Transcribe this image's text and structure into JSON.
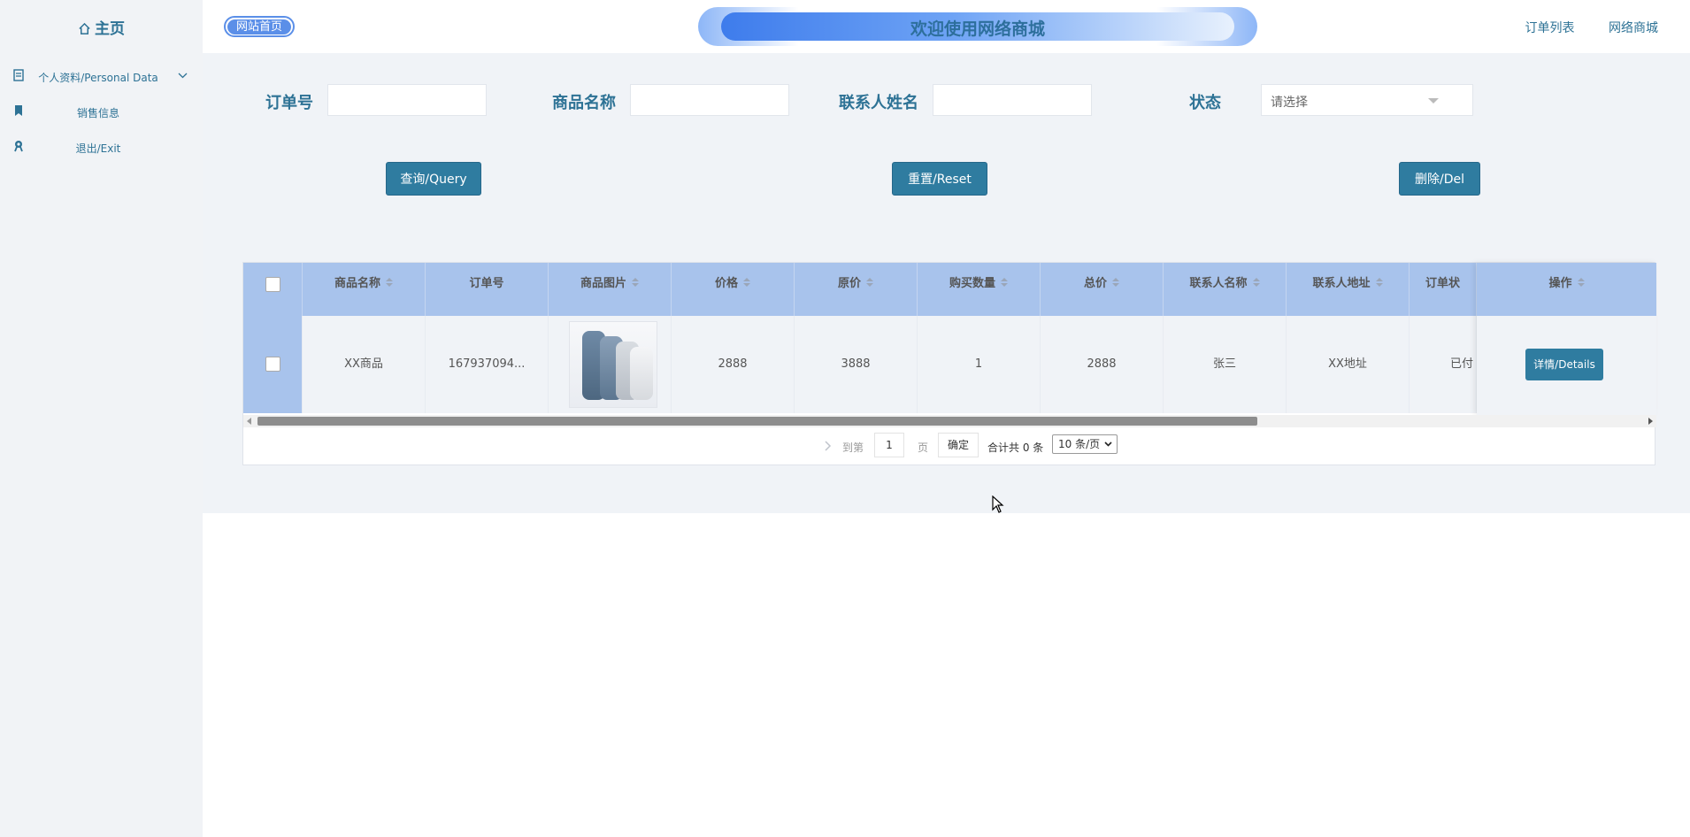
{
  "sidebar": {
    "home_label": "主页",
    "items": [
      {
        "label": "个人资料/Personal Data",
        "icon": "document-icon"
      },
      {
        "label": "销售信息",
        "icon": "bookmark-icon"
      },
      {
        "label": "退出/Exit",
        "icon": "exit-badge-icon"
      }
    ]
  },
  "header": {
    "logo_text": "网站首页",
    "banner_title": "欢迎使用网络商城",
    "links": [
      "订单列表",
      "网络商城"
    ]
  },
  "filters": {
    "order_no_label": "订单号",
    "product_name_label": "商品名称",
    "contact_name_label": "联系人姓名",
    "status_label": "状态",
    "status_placeholder": "请选择"
  },
  "actions": {
    "query": "查询/Query",
    "reset": "重置/Reset",
    "delete": "删除/Del"
  },
  "table": {
    "columns": [
      "商品名称",
      "订单号",
      "商品图片",
      "价格",
      "原价",
      "购买数量",
      "总价",
      "联系人名称",
      "联系人地址",
      "订单状"
    ],
    "operation_header": "操作",
    "rows": [
      {
        "product_name": "XX商品",
        "order_no": "167937094...",
        "price": "2888",
        "original_price": "3888",
        "quantity": "1",
        "total": "2888",
        "contact_name": "张三",
        "contact_address": "XX地址",
        "status": "已付",
        "details_label": "详情/Details"
      }
    ]
  },
  "pager": {
    "goto_label": "到第",
    "page_value": "1",
    "page_unit": "页",
    "confirm": "确定",
    "total_text": "合计共 0 条",
    "page_size": "10 条/页"
  },
  "colors": {
    "accent": "#2f7ca0",
    "header_blue": "#a8c3ec",
    "main_bg": "#f0f3f7"
  }
}
